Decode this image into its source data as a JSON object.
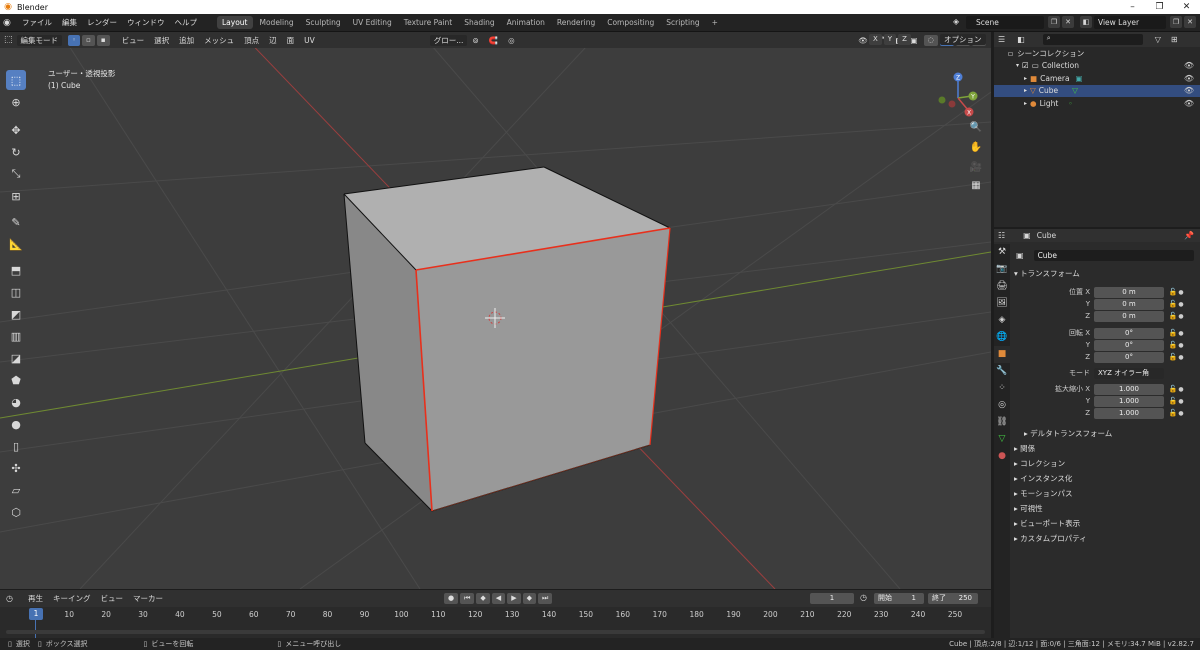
{
  "window": {
    "title": "Blender",
    "controls": [
      "–",
      "❐",
      "✕"
    ]
  },
  "menus": [
    "ファイル",
    "編集",
    "レンダー",
    "ウィンドウ",
    "ヘルプ"
  ],
  "workspaces": [
    {
      "label": "Layout",
      "active": true
    },
    {
      "label": "Modeling"
    },
    {
      "label": "Sculpting"
    },
    {
      "label": "UV Editing"
    },
    {
      "label": "Texture Paint"
    },
    {
      "label": "Shading"
    },
    {
      "label": "Animation"
    },
    {
      "label": "Rendering"
    },
    {
      "label": "Compositing"
    },
    {
      "label": "Scripting"
    }
  ],
  "scene": {
    "name": "Scene",
    "view_layer": "View Layer"
  },
  "viewport": {
    "mode": "編集モード",
    "header_menus": [
      "ビュー",
      "選択",
      "追加",
      "メッシュ",
      "頂点",
      "辺",
      "面",
      "UV"
    ],
    "transform_orientation": "グロー...",
    "options_label": "オプション",
    "axis_toggles": [
      "X",
      "Y",
      "Z"
    ],
    "info_line1": "ユーザー・透視投影",
    "info_line2": "(1) Cube",
    "gizmo": {
      "x": "X",
      "y": "Y",
      "z": "Z"
    }
  },
  "outliner": {
    "title": "シーンコレクション",
    "items": [
      {
        "label": "Collection",
        "indent": 1
      },
      {
        "label": "Camera",
        "indent": 2
      },
      {
        "label": "Cube",
        "indent": 2,
        "selected": true
      },
      {
        "label": "Light",
        "indent": 2
      }
    ]
  },
  "properties": {
    "object_name": "Cube",
    "name_field": "Cube",
    "transform_title": "トランスフォーム",
    "location_label": "位置 X",
    "location": [
      "0 m",
      "0 m",
      "0 m"
    ],
    "rotation_label": "回転 X",
    "rotation": [
      "0°",
      "0°",
      "0°"
    ],
    "mode_label": "モード",
    "mode_value": "XYZ オイラー角",
    "scale_label": "拡大縮小 X",
    "scale": [
      "1.000",
      "1.000",
      "1.000"
    ],
    "axis_y": "Y",
    "axis_z": "Z",
    "delta_transform": "デルタトランスフォーム",
    "panels": [
      "関係",
      "コレクション",
      "インスタンス化",
      "モーションパス",
      "可視性",
      "ビューポート表示",
      "カスタムプロパティ"
    ]
  },
  "timeline": {
    "menus": [
      "再生",
      "キーイング",
      "ビュー",
      "マーカー"
    ],
    "current_frame": "1",
    "current_frame_field": "1",
    "start_label": "開始",
    "start": "1",
    "end_label": "終了",
    "end": "250",
    "ruler": [
      "1",
      "10",
      "20",
      "30",
      "40",
      "50",
      "60",
      "70",
      "80",
      "90",
      "100",
      "110",
      "120",
      "130",
      "140",
      "150",
      "160",
      "170",
      "180",
      "190",
      "200",
      "210",
      "220",
      "230",
      "240",
      "250"
    ]
  },
  "status": {
    "select": "選択",
    "box_select": "ボックス選択",
    "rotate_view": "ビューを回転",
    "call_menu": "メニュー呼び出し",
    "stats": "Cube | 頂点:2/8 | 辺:1/12 | 面:0/6 | 三角面:12 | メモリ:34.7 MiB | v2.82.7"
  },
  "colors": {
    "accent": "#4772b3",
    "selected_row": "#334d80",
    "edge_select": "#e8301c",
    "x_axis": "#b34848",
    "y_axis": "#7ea33a"
  }
}
